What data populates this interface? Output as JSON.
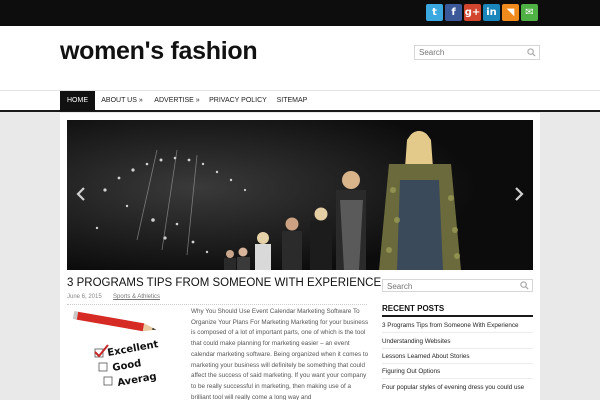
{
  "site": {
    "title": "women's fashion"
  },
  "social": {
    "items": [
      {
        "name": "twitter",
        "glyph": "t",
        "color": "#3ba9e0"
      },
      {
        "name": "facebook",
        "glyph": "f",
        "color": "#3b5998"
      },
      {
        "name": "google-plus",
        "glyph": "g+",
        "color": "#d2452f"
      },
      {
        "name": "linkedin",
        "glyph": "in",
        "color": "#1b86bc"
      },
      {
        "name": "rss",
        "glyph": "◥",
        "color": "#f08a1c"
      },
      {
        "name": "email",
        "glyph": "✉",
        "color": "#4fb043"
      }
    ]
  },
  "header": {
    "search_placeholder": "Search"
  },
  "nav": {
    "items": [
      {
        "label": "HOME"
      },
      {
        "label": "ABOUT US »"
      },
      {
        "label": "ADVERTISE »"
      },
      {
        "label": "PRIVACY POLICY"
      },
      {
        "label": "SITEMAP"
      }
    ]
  },
  "post": {
    "title": "3 PROGRAMS TIPS FROM SOMEONE WITH EXPERIENCE",
    "date": "June 6, 2015",
    "category": "Sports & Athletics",
    "thumbnail_words": [
      "Excellent",
      "Good",
      "Averag"
    ],
    "excerpt": "Why You Should Use Event Calendar Marketing Software To Organize Your Plans For Marketing Marketing for your business is composed of a lot of important parts, one of which is the tool that could make planning for marketing easier – an event calendar marketing software. Being organized when it comes to marketing your business will definitely be something that could affect the success of said marketing. If you want your company to be really successful in marketing, then making use of a brilliant tool will really come a long way and"
  },
  "sidebar": {
    "search_placeholder": "Search",
    "recent_title": "RECENT POSTS",
    "recent_posts": [
      "3 Programs Tips from Someone With Experience",
      "Understanding Websites",
      "Lessons Learned About Stories",
      "Figuring Out Options",
      "Four popular styles of evening dress you could use"
    ]
  },
  "colors": {
    "topbar": "#0d0d0d",
    "nav_active": "#111111",
    "accent_rule": "#1a1a1a"
  }
}
